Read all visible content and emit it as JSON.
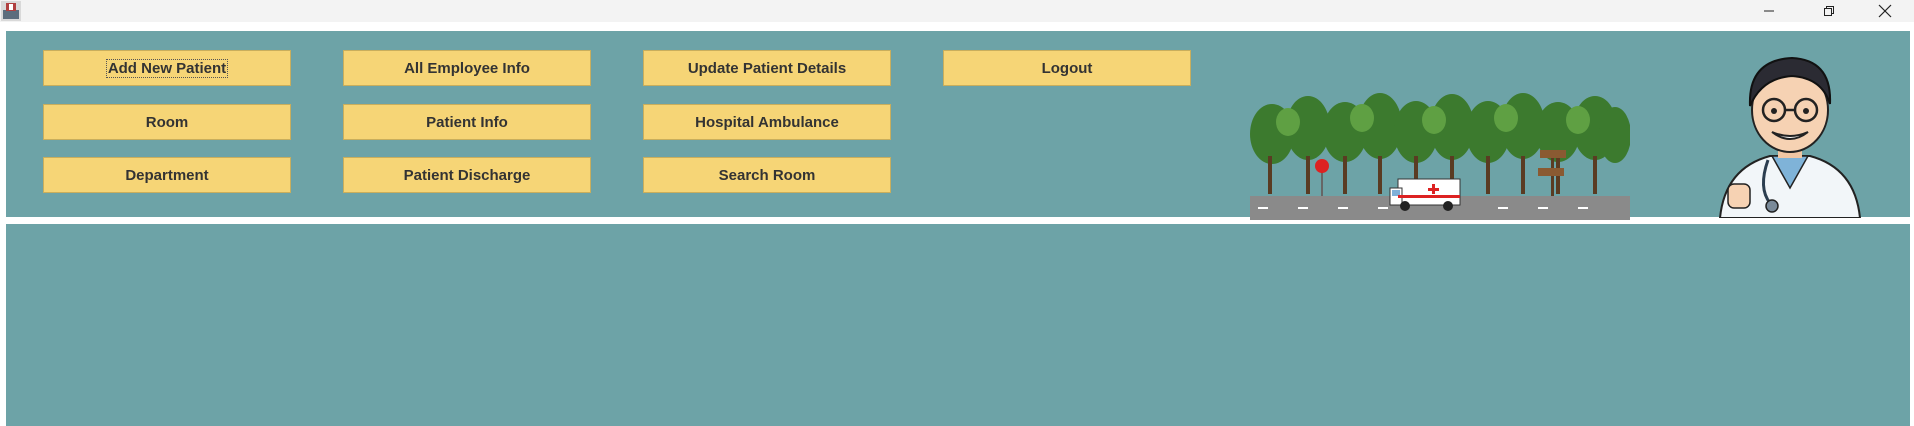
{
  "window": {
    "icon": "app-icon",
    "controls": {
      "minimize": "minimize-icon",
      "maximize": "restore-icon",
      "close": "close-icon"
    }
  },
  "menu": {
    "add_new_patient": "Add New Patient",
    "all_employee_info": "All Employee Info",
    "update_patient_details": "Update Patient Details",
    "logout": "Logout",
    "room": "Room",
    "patient_info": "Patient Info",
    "hospital_ambulance": "Hospital Ambulance",
    "department": "Department",
    "patient_discharge": "Patient Discharge",
    "search_room": "Search Room"
  },
  "colors": {
    "panel": "#6da3a7",
    "button": "#f6d576",
    "button_border": "#c9ae5c",
    "button_text": "#333333"
  },
  "images": {
    "scene": "ambulance-road-scene",
    "doctor": "doctor-illustration"
  }
}
